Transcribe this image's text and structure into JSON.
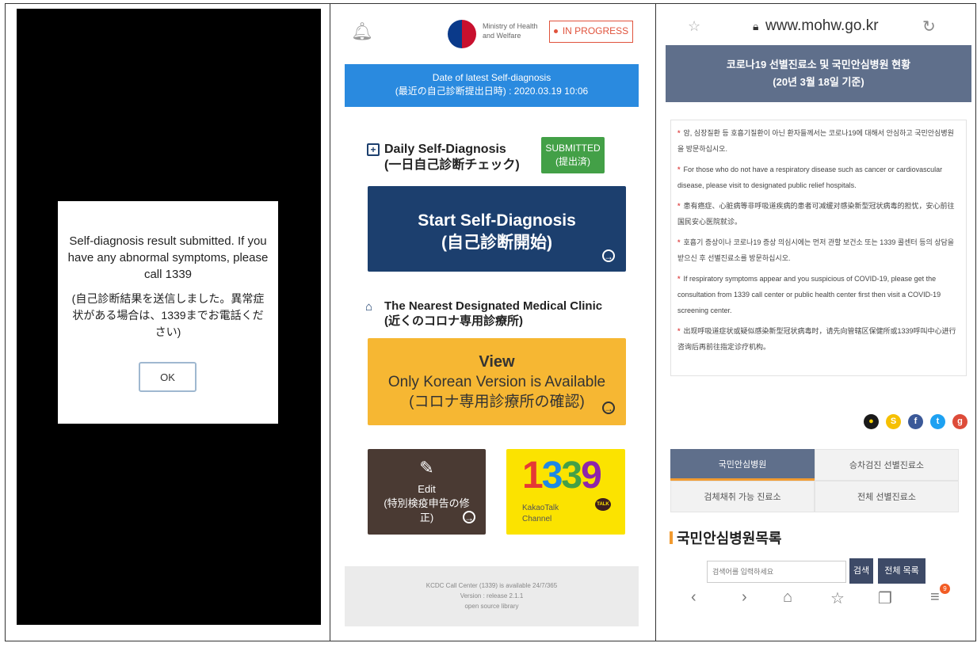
{
  "panel1": {
    "message": "Self-diagnosis result submitted. If you have any abnormal symptoms, please call 1339",
    "message_jp": "(自己診断結果を送信しました。異常症状がある場合は、1339までお電話ください)",
    "ok_label": "OK"
  },
  "panel2": {
    "ministry": "Ministry of Health and Welfare",
    "status_label": "IN PROGRESS",
    "latest_label": "Date of latest Self-diagnosis",
    "latest_value": "(最近の自己診断提出日時) : 2020.03.19 10:06",
    "daily_title": "Daily Self-Diagnosis",
    "daily_title_jp": "(一日自己診断チェック)",
    "submitted_label": "SUBMITTED",
    "submitted_label_jp": "(提出済)",
    "start_label": "Start Self-Diagnosis",
    "start_label_jp": "(自己診断開始)",
    "nearest_title": "The Nearest Designated Medical Clinic",
    "nearest_title_jp": "(近くのコロナ専用診療所)",
    "view_label": "View",
    "view_note": "Only Korean Version is Available",
    "view_jp": "(コロナ専用診療所の確認)",
    "edit_label": "Edit",
    "edit_jp": "(特別検疫申告の修正)",
    "kakao_number": "1339",
    "kakao_label": "KakaoTalk Channel",
    "kakao_badge": "TALK",
    "footer_line1": "KCDC Call Center (1339) is available 24/7/365",
    "footer_line2": "Version : release 2.1.1",
    "footer_line3": "open source library"
  },
  "panel3": {
    "url": "www.mohw.go.kr",
    "header_line1": "코로나19 선별진료소 및 국민안심병원 현황",
    "header_line2": "(20년 3월 18일 기준)",
    "notes": [
      "암, 심장질환 등 호흡기질환이 아닌 환자들께서는 코로나19에 대해서 안심하고 국민안심병원을 방문하십시오.",
      "For those who do not have a respiratory disease such as cancer or cardiovascular disease, please visit to designated public relief hospitals.",
      "患有癌症、心脏病等非呼吸道疾病的患者可减缓对感染新型冠状病毒的担忧，安心前往国民安心医院就诊。",
      "호흡기 증상이나 코로나19 증상 의심시에는 먼저 관할 보건소 또는 1339 콜센터 등의 상담을 받으신 후 선별진료소를 방문하십시오.",
      "If respiratory symptoms appear and you suspicious of COVID-19, please get the consultation from 1339 call center or public health center first then visit a COVID-19 screening center.",
      "出现呼吸道症状或疑似感染新型冠状病毒时，请先向管辖区保健所或1339呼叫中心进行咨询后再前往指定诊疗机构。"
    ],
    "tabs": [
      "국민안심병원",
      "승차검진 선별진료소",
      "검체채취 가능 진료소",
      "전체 선별진료소"
    ],
    "list_title": "국민안심병원목록",
    "search_placeholder": "검색어를 입력하세요",
    "search_btn": "검색",
    "list_btn": "전체 목록",
    "menu_badge": "9"
  }
}
